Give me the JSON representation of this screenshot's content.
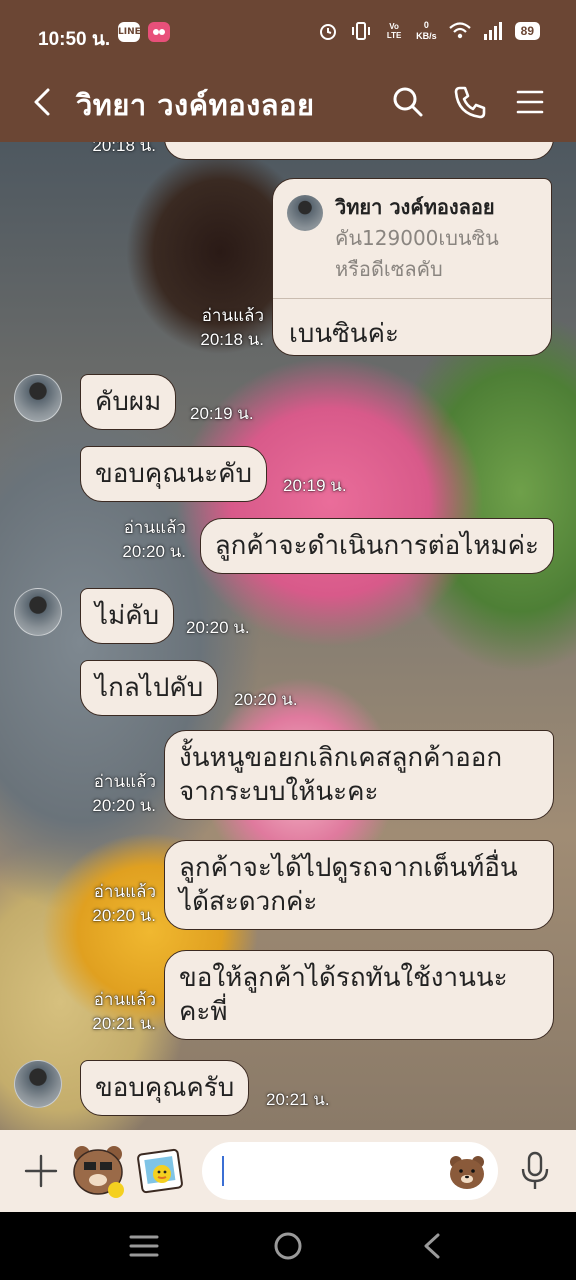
{
  "status_bar": {
    "time": "10:50 น.",
    "left_icons": [
      "line-app-icon",
      "sticker-app-icon"
    ],
    "line_badge": "LINE",
    "net_speed_value": "0",
    "net_speed_unit": "KB/s",
    "volte": "Vo LTE",
    "battery": "89",
    "right_icons": [
      "alarm-icon",
      "vibrate-icon",
      "volte-icon",
      "wifi-icon",
      "signal-icon",
      "battery-icon"
    ]
  },
  "header": {
    "title": "วิทยา วงค์ทองลอย",
    "icons": [
      "back-icon",
      "search-icon",
      "phone-icon",
      "menu-icon"
    ]
  },
  "messages": {
    "top_partial_time": "20:18 น.",
    "reply": {
      "quoted_name": "วิทยา วงค์ทองลอย",
      "quoted_line1": "คัน129000เบนซิน",
      "quoted_line2": "หรือดีเซลคับ",
      "text": "เบนซินค่ะ",
      "read": "อ่านแล้ว",
      "time": "20:18 น."
    },
    "m1": {
      "text": "คับผม",
      "time": "20:19 น."
    },
    "m2": {
      "text": "ขอบคุณนะคับ",
      "time": "20:19 น."
    },
    "m3": {
      "text": "ลูกค้าจะดำเนินการต่อไหมค่ะ",
      "read": "อ่านแล้ว",
      "time": "20:20 น."
    },
    "m4": {
      "text": "ไม่คับ",
      "time": "20:20 น."
    },
    "m5": {
      "text": "ไกลไปคับ",
      "time": "20:20 น."
    },
    "m6": {
      "line1": "งั้นหนูขอยกเลิกเคสลูกค้าออก",
      "line2": "จากระบบให้นะคะ",
      "read": "อ่านแล้ว",
      "time": "20:20 น."
    },
    "m7": {
      "line1": "ลูกค้าจะได้ไปดูรถจากเต็นท์อื่น",
      "line2": "ได้สะดวกค่ะ",
      "read": "อ่านแล้ว",
      "time": "20:20 น."
    },
    "m8": {
      "line1": "ขอให้ลูกค้าได้รถทันใช้งานนะ",
      "line2": "คะพี่",
      "read": "อ่านแล้ว",
      "time": "20:21 น."
    },
    "m9": {
      "text": "ขอบคุณครับ",
      "time": "20:21 น."
    }
  },
  "input_bar": {
    "icons": [
      "plus-icon",
      "brown-bear-sticker-icon",
      "image-sticker-icon",
      "emoji-bear-icon",
      "microphone-icon"
    ],
    "input_value": ""
  },
  "nav_bar": {
    "icons": [
      "recent-apps-icon",
      "home-icon",
      "nav-back-icon"
    ]
  },
  "colors": {
    "header_bg": "#6b4634",
    "bubble_bg": "#f4ebe3",
    "bubble_border": "#3b2a22",
    "input_bar_bg": "#f4ebe3",
    "caret": "#3b6fd4"
  }
}
